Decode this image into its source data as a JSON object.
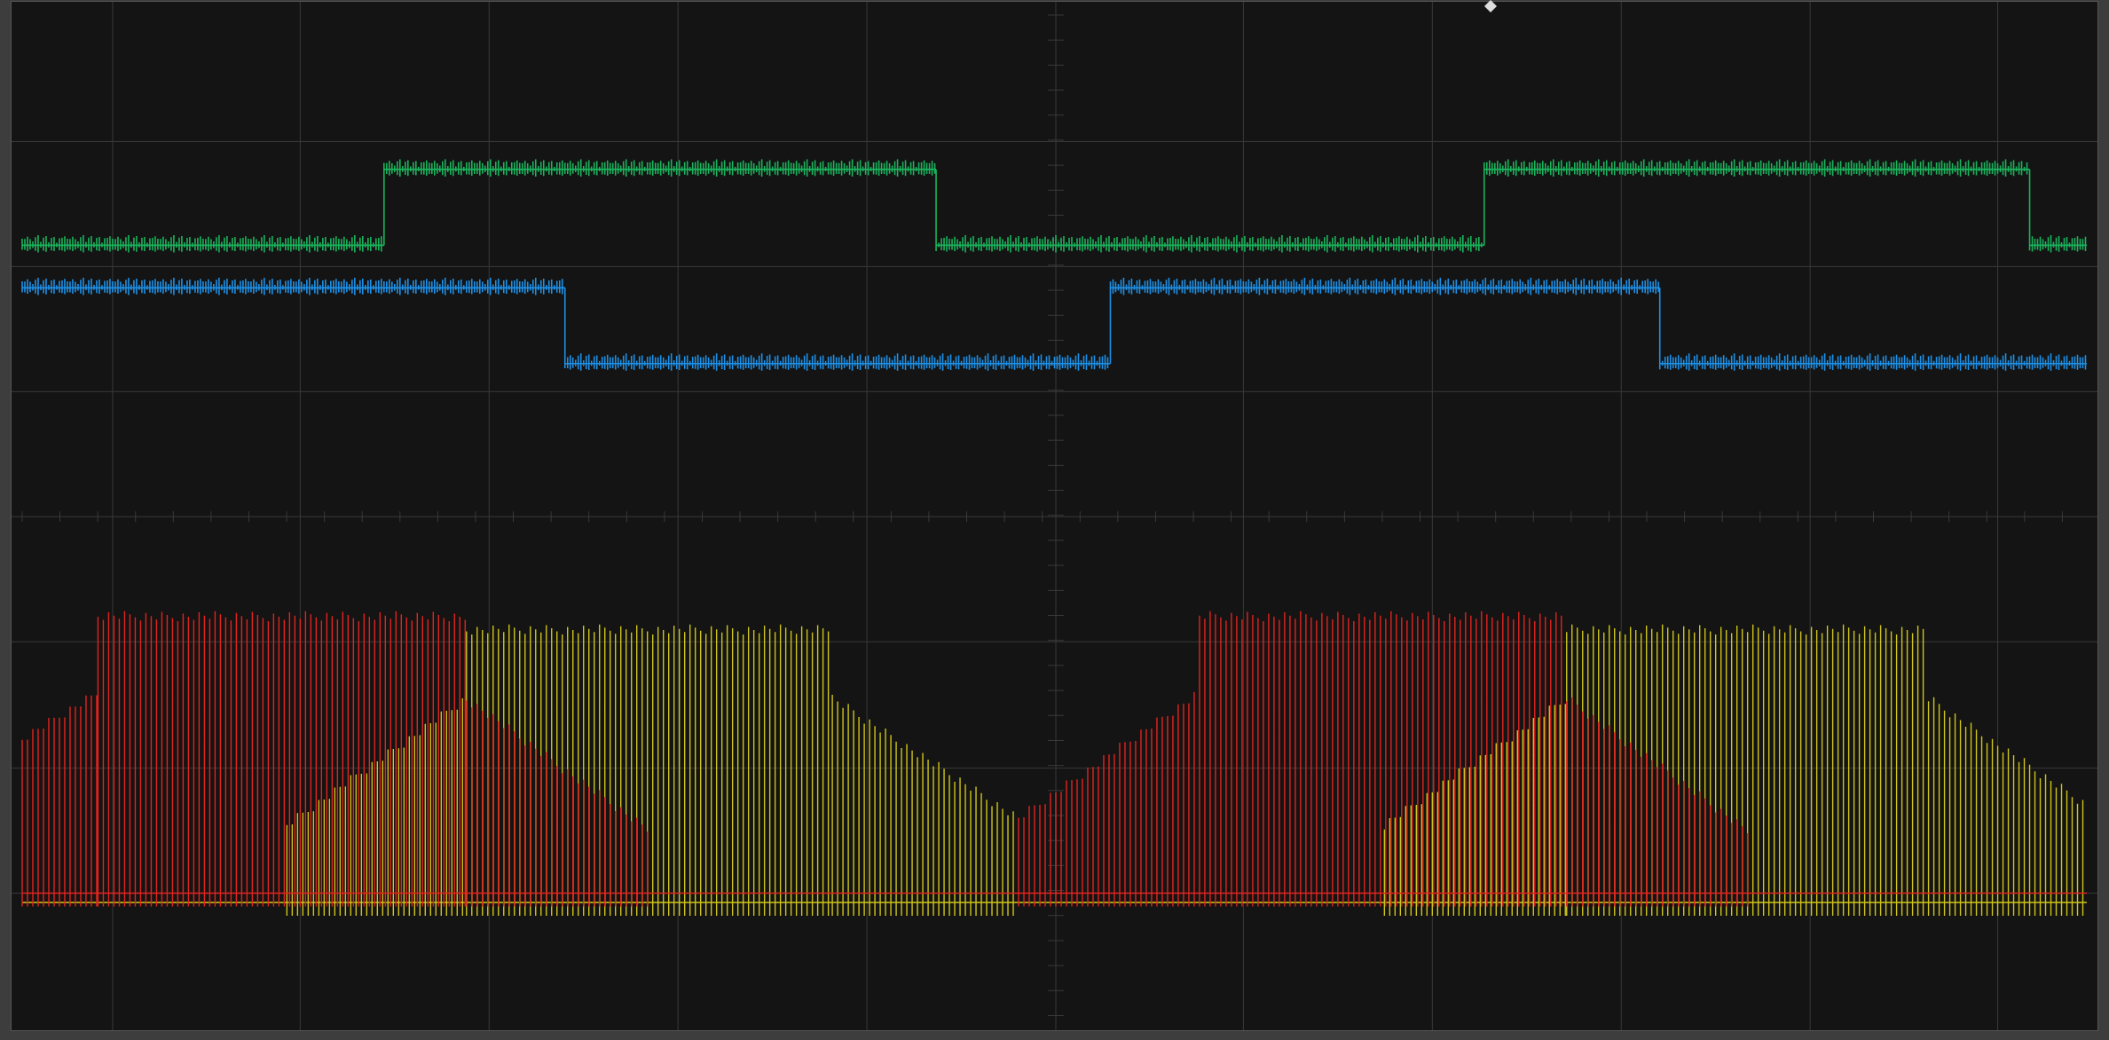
{
  "traces": [
    {
      "color": "#1bb35c"
    },
    {
      "color": "#1e90e6"
    },
    {
      "color": "#cfc51a"
    },
    {
      "color": "#e2241f"
    }
  ]
}
